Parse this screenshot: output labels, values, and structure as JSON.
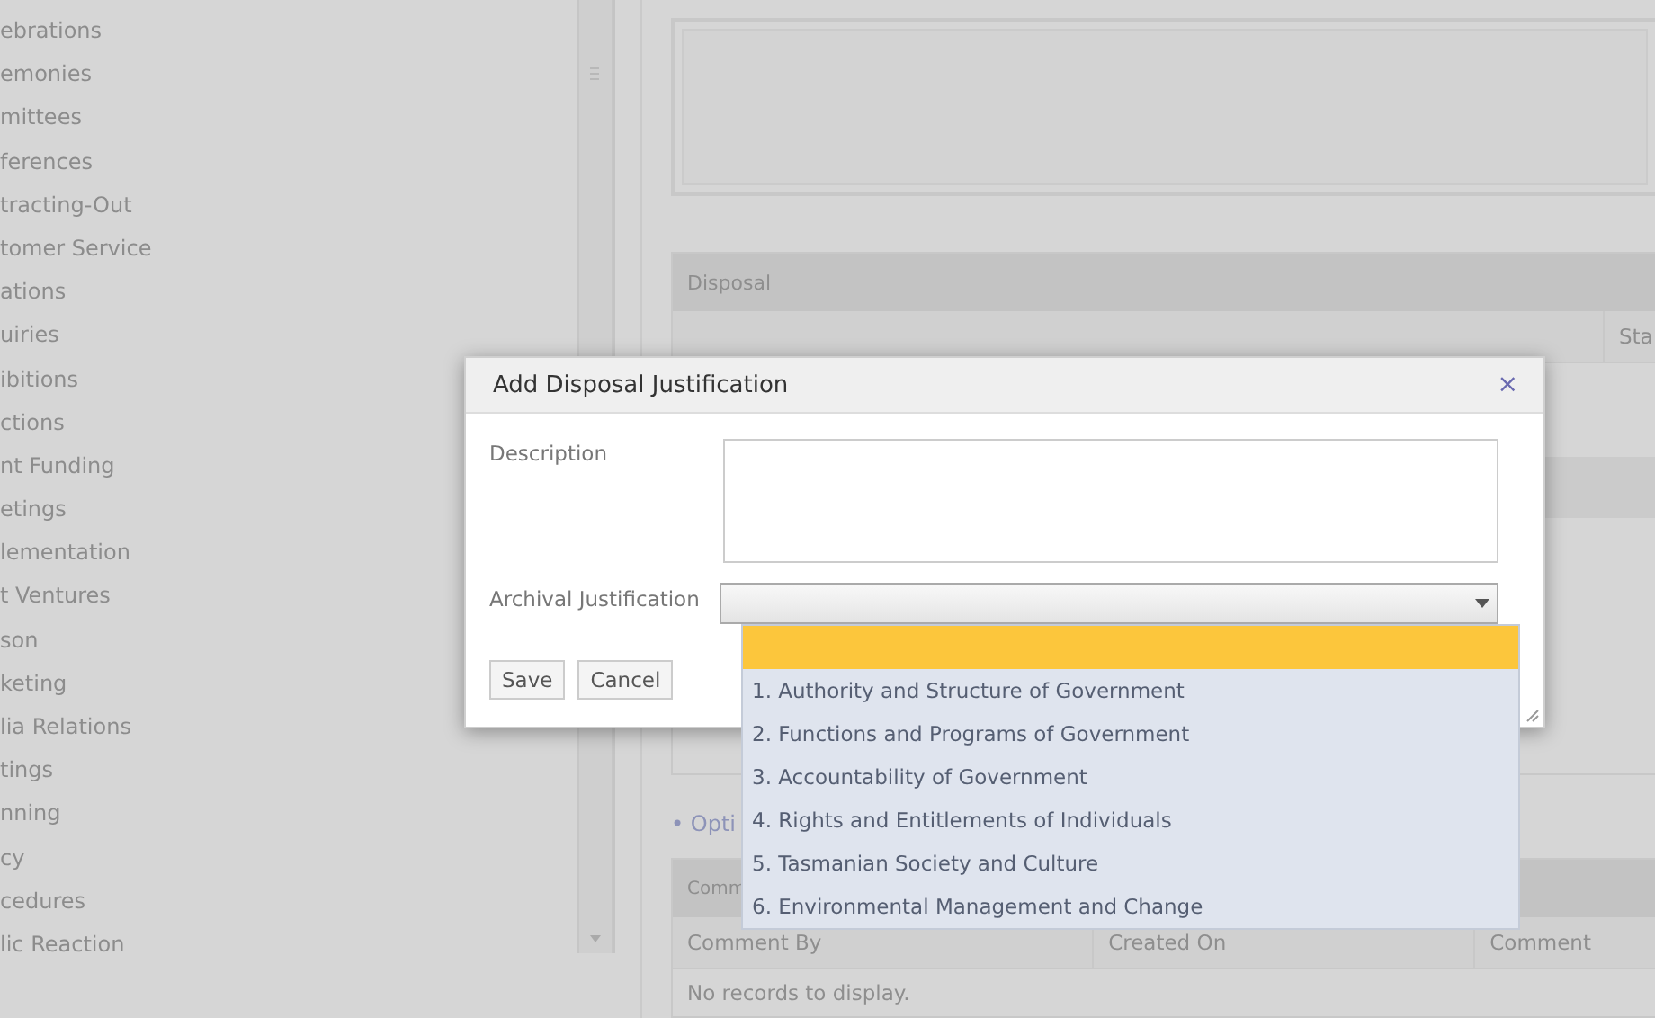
{
  "sidebar": {
    "items": [
      "ebrations",
      "emonies",
      "mittees",
      "ferences",
      "tracting-Out",
      "tomer Service",
      "ations",
      "uiries",
      "ibitions",
      "ctions",
      "nt Funding",
      "etings",
      "lementation",
      "t Ventures",
      "son",
      "keting",
      "lia Relations",
      "tings",
      "nning",
      "cy",
      "cedures",
      "lic Reaction"
    ]
  },
  "disposal_panel": {
    "title": "Disposal",
    "columns": [
      "Sta"
    ]
  },
  "options_link": "• Opti",
  "comments_panel": {
    "title": "Comm",
    "columns": [
      "Comment By",
      "Created On",
      "Comment"
    ],
    "empty_text": "No records to display."
  },
  "dialog": {
    "title": "Add Disposal Justification",
    "close": "×",
    "fields": [
      {
        "kind": "textarea",
        "label": "Description"
      },
      {
        "kind": "select",
        "label": "Archival Justification",
        "expanded": true
      }
    ],
    "buttons": [
      "Save",
      "Cancel"
    ]
  },
  "dropdown": {
    "blank_highlighted": true,
    "options": [
      {
        "label": "1. Authority and Structure of Government",
        "selected": false
      },
      {
        "label": "2. Functions and Programs of Government",
        "selected": false
      },
      {
        "label": "3. Accountability of Government",
        "selected": false
      },
      {
        "label": "4. Rights and Entitlements of Individuals",
        "selected": false
      },
      {
        "label": "5. Tasmanian Society and Culture",
        "selected": false
      },
      {
        "label": "6. Environmental Management and Change",
        "selected": false
      }
    ]
  }
}
